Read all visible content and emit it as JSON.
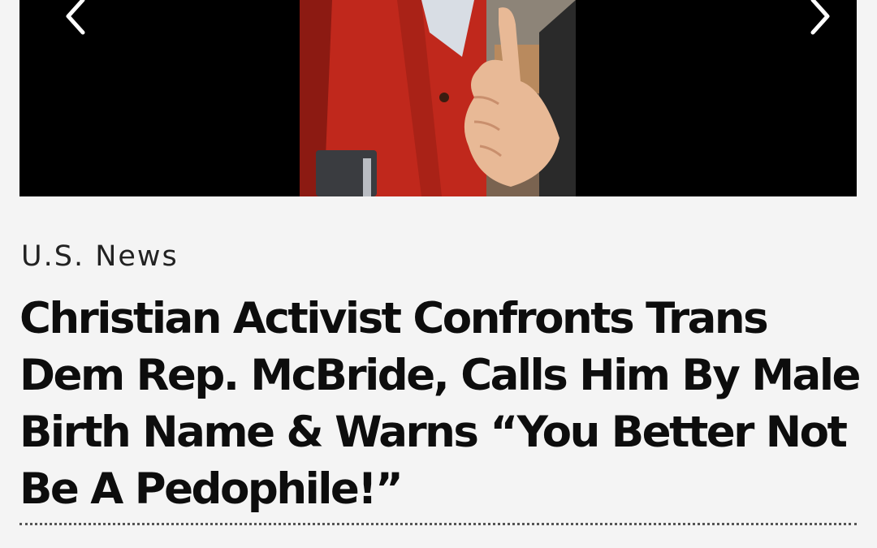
{
  "carousel": {
    "prev_icon": "chevron-left-icon",
    "next_icon": "chevron-right-icon",
    "image_alt": "Photo of a person in a red blazer being confronted"
  },
  "article": {
    "category": "U.S. News",
    "headline": "Christian Activist Confronts Trans Dem Rep. McBride, Calls Him By Male Birth Name & Warns “You Better Not Be A Pedophile!”"
  },
  "colors": {
    "background": "#f4f4f4",
    "text": "#0d0d0d",
    "blazer": "#c0281c"
  }
}
